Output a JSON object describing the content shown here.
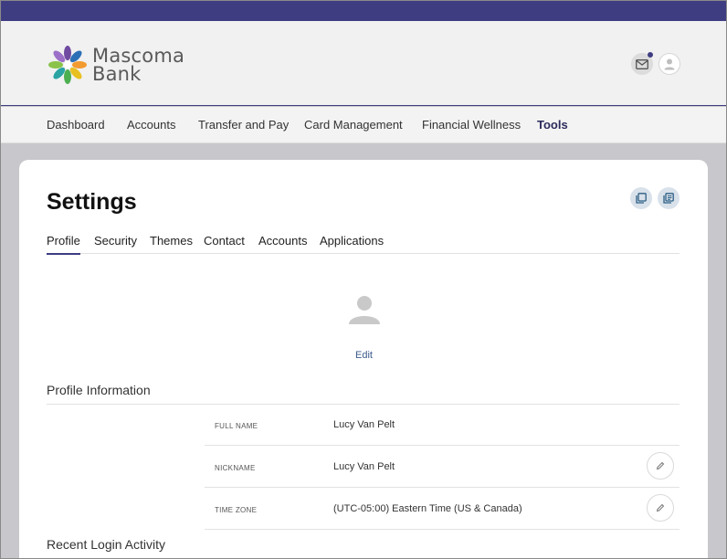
{
  "brand": {
    "name_line1": "Mascoma",
    "name_line2": "Bank",
    "colors": {
      "primary": "#3f3d82",
      "blue": "#2b6fb6",
      "green": "#4caf50",
      "orange": "#f29b30",
      "purple": "#6f4aa0"
    }
  },
  "header": {
    "mail_icon": "mail-icon",
    "user_icon": "user-icon"
  },
  "nav": {
    "items": [
      {
        "label": "Dashboard"
      },
      {
        "label": "Accounts"
      },
      {
        "label": "Transfer and Pay"
      },
      {
        "label": "Card Management"
      },
      {
        "label": "Financial Wellness"
      },
      {
        "label": "Tools",
        "active": true
      }
    ]
  },
  "settings": {
    "title": "Settings",
    "tabs": [
      {
        "label": "Profile",
        "active": true
      },
      {
        "label": "Security"
      },
      {
        "label": "Themes"
      },
      {
        "label": "Contact"
      },
      {
        "label": "Accounts"
      },
      {
        "label": "Applications"
      }
    ],
    "avatar_edit_label": "Edit",
    "profile_section_title": "Profile Information",
    "fields": [
      {
        "label": "FULL NAME",
        "value": "Lucy Van Pelt",
        "editable": false
      },
      {
        "label": "NICKNAME",
        "value": "Lucy Van Pelt",
        "editable": true
      },
      {
        "label": "TIME ZONE",
        "value": "(UTC-05:00) Eastern Time (US & Canada)",
        "editable": true
      }
    ],
    "login_section_title": "Recent Login Activity"
  }
}
